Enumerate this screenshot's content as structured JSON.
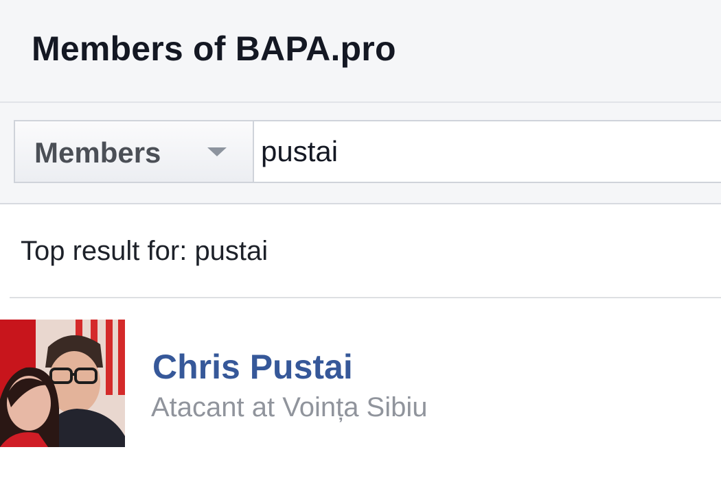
{
  "header": {
    "title": "Members of BAPA.pro"
  },
  "search": {
    "filter_label": "Members",
    "query": "pustai"
  },
  "results": {
    "heading": "Top result for: pustai",
    "items": [
      {
        "name": "Chris Pustai",
        "subtitle": "Atacant at Voința Sibiu"
      }
    ]
  },
  "icons": {
    "filter_caret": "caret-down-icon"
  },
  "colors": {
    "header_bg": "#f5f6f8",
    "title_text": "#141823",
    "link_blue": "#365899",
    "subtitle_gray": "#90949c"
  }
}
